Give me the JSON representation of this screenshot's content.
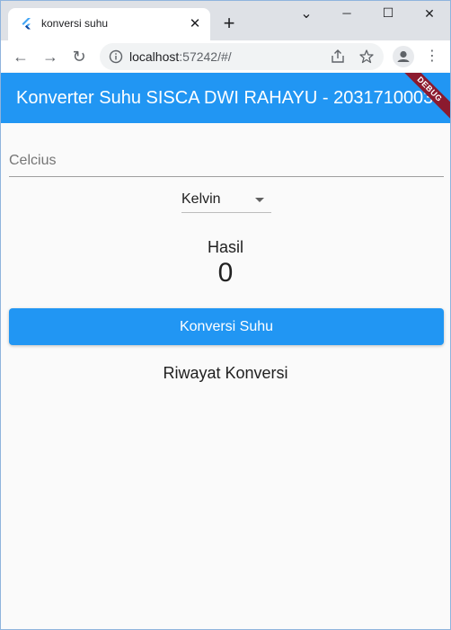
{
  "browser": {
    "tab_title": "konversi suhu",
    "tab_close": "✕",
    "new_tab": "+",
    "url_host": "localhost",
    "url_rest": ":57242/#/",
    "controls": {
      "minimize": "─",
      "maximize": "☐",
      "close": "✕",
      "menu_chevron": "⌄"
    },
    "nav": {
      "back": "←",
      "forward": "→",
      "reload": "↻"
    },
    "menu_dots": "⋮"
  },
  "appbar": {
    "title": "Konverter Suhu SISCA DWI RAHAYU - 2031710003",
    "debug_label": "DEBUG",
    "color": "#2196f3"
  },
  "form": {
    "input_placeholder": "Celcius",
    "input_value": "",
    "dropdown_selected": "Kelvin"
  },
  "result": {
    "label": "Hasil",
    "value": "0"
  },
  "actions": {
    "convert_label": "Konversi Suhu"
  },
  "history": {
    "title": "Riwayat Konversi"
  },
  "icons": {
    "favicon": "flutter-icon",
    "info": "info-icon",
    "share": "share-icon",
    "bookmark": "star-icon",
    "profile": "profile-icon"
  }
}
